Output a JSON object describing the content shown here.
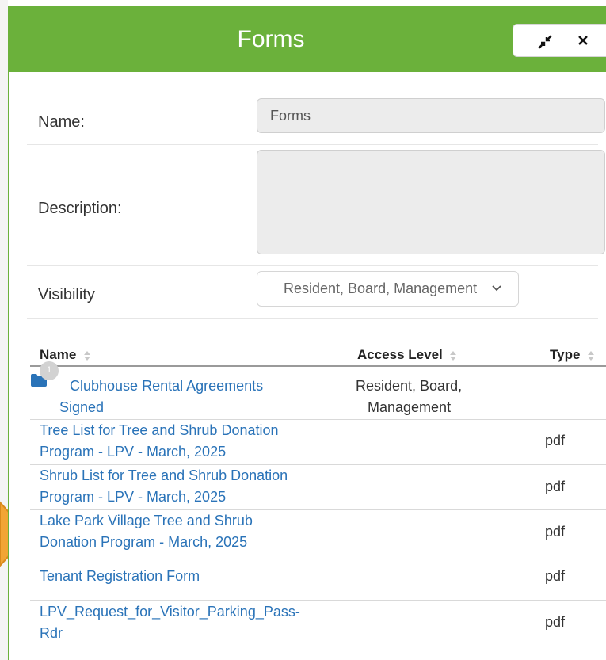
{
  "modal": {
    "title": "Forms",
    "collapse_icon": "collapse-arrows-icon",
    "close_icon": "close-icon"
  },
  "form": {
    "name_label": "Name:",
    "name_value": "Forms",
    "description_label": "Description:",
    "description_value": "",
    "visibility_label": "Visibility",
    "visibility_value": "Resident, Board, Management"
  },
  "table": {
    "headers": [
      "Name",
      "Access Level",
      "Type"
    ],
    "rows": [
      {
        "name_line1": "Clubhouse Rental Agreements",
        "name_line2": "Signed",
        "access_line1": "Resident, Board,",
        "access_line2": "Management",
        "type": "",
        "is_folder": true,
        "badge": "1"
      },
      {
        "name_line1": "Tree List for Tree and Shrub Donation",
        "name_line2": "Program - LPV - March, 2025",
        "access_line1": "",
        "access_line2": "",
        "type": "pdf"
      },
      {
        "name_line1": "Shrub List for Tree and Shrub Donation",
        "name_line2": "Program - LPV - March, 2025",
        "access_line1": "",
        "access_line2": "",
        "type": "pdf"
      },
      {
        "name_line1": "Lake Park Village Tree and Shrub",
        "name_line2": "Donation Program - March, 2025",
        "access_line1": "",
        "access_line2": "",
        "type": "pdf"
      },
      {
        "name_line1": "Tenant Registration Form",
        "name_line2": "",
        "access_line1": "",
        "access_line2": "",
        "type": "pdf"
      },
      {
        "name_line1": "LPV_Request_for_Visitor_Parking_Pass-",
        "name_line2": "Rdr",
        "access_line1": "",
        "access_line2": "",
        "type": "pdf"
      }
    ]
  },
  "colors": {
    "header_green": "#6bb13b",
    "link_blue": "#2a73b8",
    "arrow_orange": "#f2a535"
  }
}
